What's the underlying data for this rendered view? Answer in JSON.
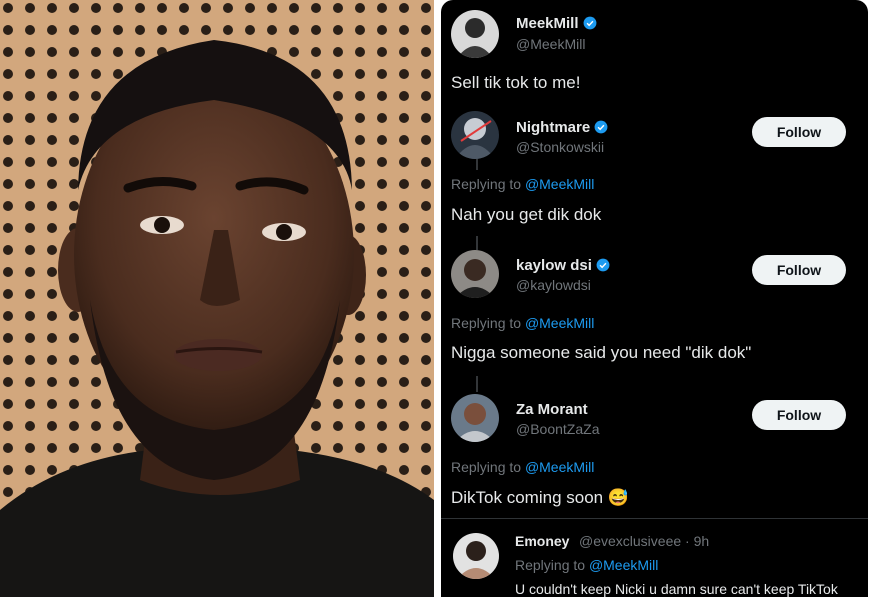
{
  "photo": {
    "description_icon": "portrait-photo"
  },
  "tweets": {
    "main": {
      "name": "MeekMill",
      "handle": "@MeekMill",
      "text": "Sell tik tok to me!"
    },
    "reply1": {
      "name": "Nightmare",
      "handle": "@Stonkowskii",
      "replying_prefix": "Replying to ",
      "replying_to": "@MeekMill",
      "text": "Nah you get dik dok",
      "follow_label": "Follow"
    },
    "reply2": {
      "name": "kaylow dsi",
      "handle": "@kaylowdsi",
      "replying_prefix": "Replying to ",
      "replying_to": "@MeekMill",
      "text": "Nigga someone said you need \"dik dok\"",
      "follow_label": "Follow"
    },
    "reply3": {
      "name": "Za Morant",
      "handle": "@BoontZaZa",
      "replying_prefix": "Replying to ",
      "replying_to": "@MeekMill",
      "text": "DikTok coming soon",
      "emoji": "😅",
      "follow_label": "Follow"
    },
    "reply4": {
      "name": "Emoney",
      "handle": "@evexclusiveee",
      "time": "· 9h",
      "replying_prefix": "Replying to ",
      "replying_to": "@MeekMill",
      "text": "U couldn't keep Nicki u damn sure can't keep TikTok"
    }
  },
  "colors": {
    "background": "#000000",
    "link": "#1d9bf0",
    "muted": "#71767b",
    "verified": "#1d9bf0",
    "follow_button": "#eff3f4"
  }
}
